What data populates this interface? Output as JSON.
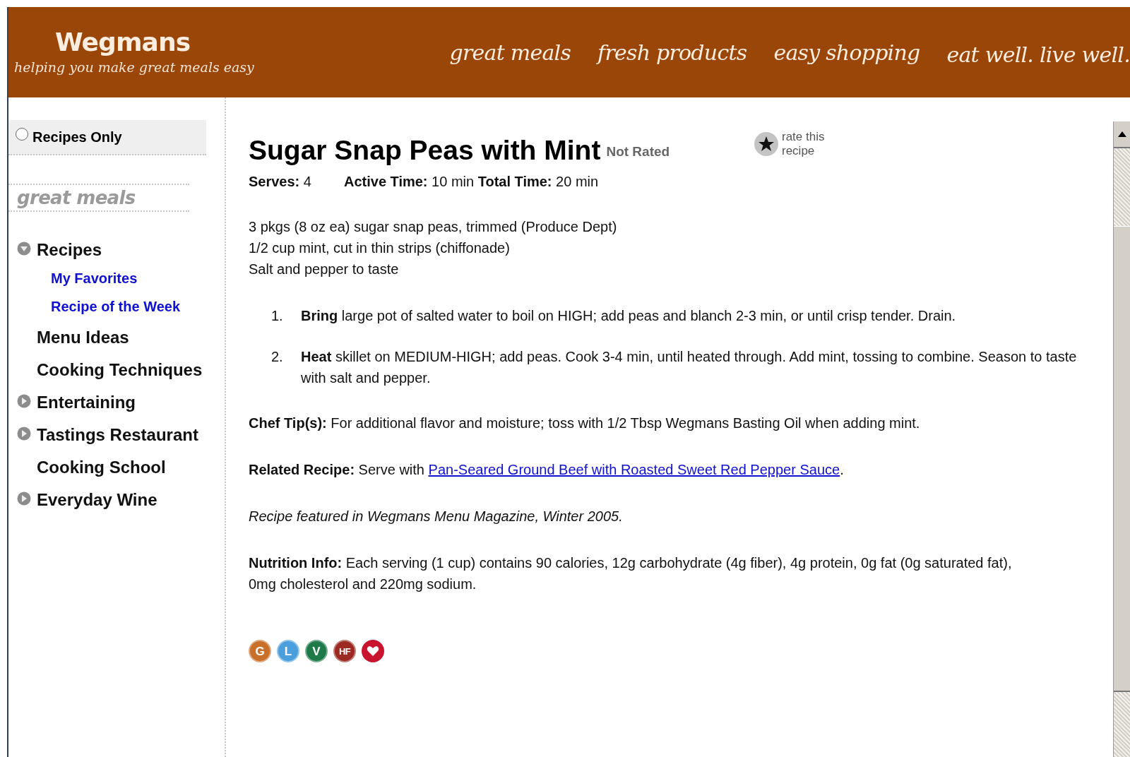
{
  "header": {
    "logo": "Wegmans",
    "tagline": "helping you make great meals easy",
    "nav": [
      {
        "label": "great meals"
      },
      {
        "label": "fresh products"
      },
      {
        "label": "easy shopping"
      },
      {
        "label": "eat well. live well."
      }
    ]
  },
  "sidebar": {
    "filter": {
      "label": "Recipes Only",
      "checked": false
    },
    "heading": "great meals",
    "items": [
      {
        "label": "Recipes",
        "kind": "group",
        "expanded": true,
        "children": [
          {
            "label": "My Favorites"
          },
          {
            "label": "Recipe of the Week"
          }
        ]
      },
      {
        "label": "Menu Ideas",
        "kind": "page"
      },
      {
        "label": "Cooking Techniques",
        "kind": "page"
      },
      {
        "label": "Entertaining",
        "kind": "group",
        "expanded": false
      },
      {
        "label": "Tastings Restaurant",
        "kind": "group",
        "expanded": false
      },
      {
        "label": "Cooking School",
        "kind": "page"
      },
      {
        "label": "Everyday Wine",
        "kind": "group",
        "expanded": false
      }
    ]
  },
  "recipe": {
    "title": "Sugar Snap Peas with Mint",
    "rating": "Not Rated",
    "rate_link": "rate this recipe",
    "facts": [
      "**Serves:** 4",
      "**Active Time:** 10 min **Total Time:** 20 min"
    ],
    "ingredients": [
      "3 pkgs (8 oz ea) sugar snap peas, trimmed (Produce Dept)",
      "1/2 cup mint, cut in thin strips (chiffonade)",
      "Salt and pepper to taste"
    ],
    "steps": [
      {
        "number": "1.",
        "text": "**Bring** large pot of salted water to boil on HIGH; add peas and blanch 2-3 min, or until crisp tender. Drain."
      },
      {
        "number": "2.",
        "text": "**Heat** skillet on MEDIUM-HIGH; add peas. Cook 3-4 min, until heated through. Add mint, tossing to combine. Season to taste with salt and pepper."
      }
    ],
    "chef_tip": "**Chef Tip(s):** For additional flavor and moisture; toss with 1/2 Tbsp Wegmans Basting Oil when adding mint.",
    "related": {
      "lead": "**Related Recipe:** Serve with",
      "link": "Pan-Seared Ground Beef with Roasted Sweet Red Pepper Sauce",
      "end": "."
    },
    "source": "Recipe featured in Wegmans Menu Magazine, Winter 2005.",
    "nutrition": "**Nutrition Info:**  Each serving (1 cup) contains 90 calories, 12g carbohydrate (4g fiber), 4g protein, 0g fat (0g saturated fat), 0mg cholesterol and 220mg sodium.",
    "badges": [
      {
        "kind": "letter",
        "label": "G",
        "color": "#c8702a"
      },
      {
        "kind": "letter",
        "label": "L",
        "color": "#4a9fdc"
      },
      {
        "kind": "letter",
        "label": "V",
        "color": "#1f7a4a"
      },
      {
        "kind": "letter",
        "label": "HF",
        "color": "#9b2a22"
      },
      {
        "kind": "heart",
        "color": "#c8142e"
      }
    ]
  }
}
